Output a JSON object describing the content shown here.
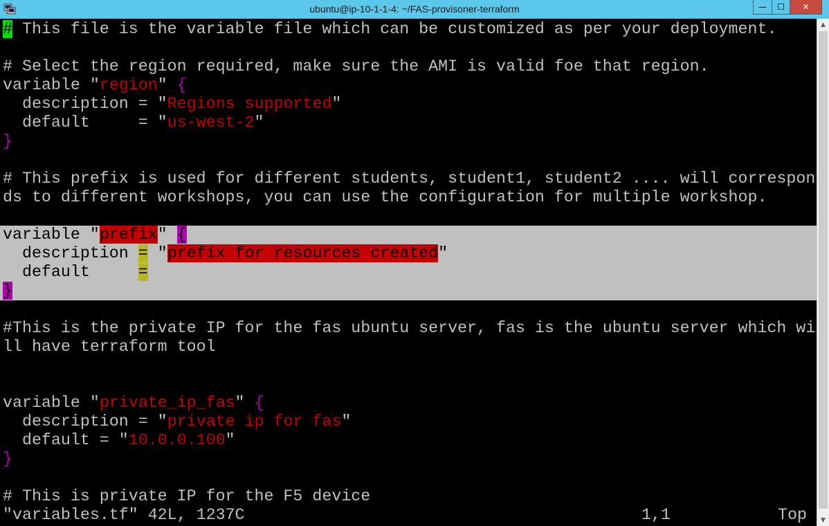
{
  "window": {
    "title": "ubuntu@ip-10-1-1-4: ~/FAS-provisoner-terraform",
    "icon": "putty-icon",
    "controls": {
      "minimize": "—",
      "maximize": "☐",
      "close": "✕"
    }
  },
  "colors": {
    "titlebar": "#5ac7eb",
    "background": "#000000",
    "text": "#c0c0c0",
    "string": "#c40000",
    "brace": "#b000b0",
    "selection": "#c0c0c0",
    "cursor": "#00e000",
    "match_equals": "#b8b820"
  },
  "editor": {
    "line1_cursor": "#",
    "line1_rest": " This file is the variable file which can be customized as per your deployment.",
    "line3": "# Select the region required, make sure the AMI is valid foe that region.",
    "region": {
      "decl_pre": "variable \"",
      "name": "region",
      "decl_mid": "\" ",
      "open": "{",
      "desc_pre": "  description = \"",
      "desc_val": "Regions supported",
      "desc_post": "\"",
      "def_pre": "  default     = \"",
      "def_val": "us-west-2",
      "def_post": "\"",
      "close": "}"
    },
    "prefix_comment_1": "# This prefix is used for different students, student1, student2 .... will correspon",
    "prefix_comment_2": "ds to different workshops, you can use the configuration for multiple workshop.",
    "prefix": {
      "decl_pre": "variable \"",
      "name": "prefix",
      "decl_mid": "\" ",
      "open": "{",
      "desc_pre": "  description ",
      "desc_eq": "=",
      "desc_mid": " \"",
      "desc_val": "prefix for resources created",
      "desc_post": "\"",
      "def_pre": "  default     ",
      "def_eq": "=",
      "close": "}"
    },
    "fas_comment_1": "#This is the private IP for the fas ubuntu server, fas is the ubuntu server which wi",
    "fas_comment_2": "ll have terraform tool",
    "private_ip_fas": {
      "decl_pre": "variable \"",
      "name": "private_ip_fas",
      "decl_mid": "\" ",
      "open": "{",
      "desc_pre": "  description = \"",
      "desc_val": "private ip for fas",
      "desc_post": "\"",
      "def_pre": "  default = \"",
      "def_val": "10.0.0.100",
      "def_post": "\"",
      "close": "}"
    },
    "f5_comment": "# This is private IP for the F5 device"
  },
  "status_line": {
    "file_info": "\"variables.tf\" 42L, 1237C",
    "position": "1,1",
    "scroll": "Top"
  }
}
